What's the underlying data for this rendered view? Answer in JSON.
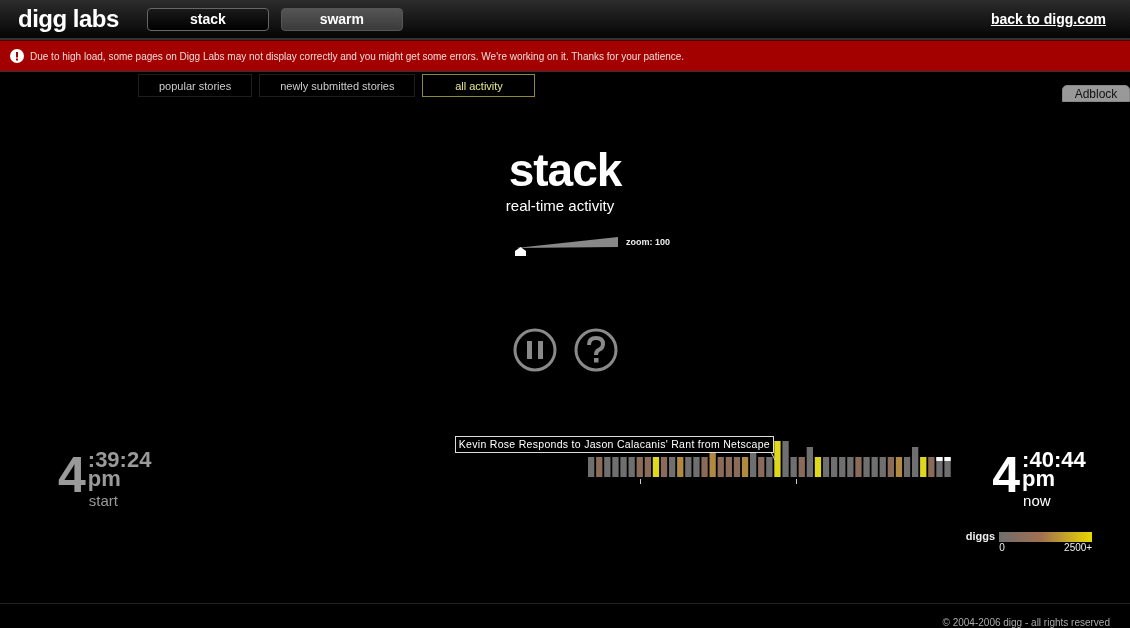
{
  "header": {
    "logo": "digg labs",
    "tabs": [
      {
        "label": "stack",
        "selected": true
      },
      {
        "label": "swarm",
        "selected": false
      }
    ],
    "back_link": "back to digg.com"
  },
  "alert": {
    "message": "Due to high load, some pages on Digg Labs may not display correctly and you might get some errors. We're working on it. Thanks for your patience."
  },
  "filter_tabs": [
    {
      "label": "popular stories",
      "selected": false
    },
    {
      "label": "newly submitted stories",
      "selected": false
    },
    {
      "label": "all activity",
      "selected": true
    }
  ],
  "adblock_tab": "Adblock",
  "title": "stack",
  "subtitle": "real-time activity",
  "zoom": {
    "label": "zoom: 100",
    "level": 0.03
  },
  "timeline": {
    "tooltip": "Kevin Rose Responds to Jason Calacanis' Rant from Netscape",
    "start": {
      "hour": "4",
      "minsec": ":39:24",
      "ampm": "pm",
      "label": "start"
    },
    "now": {
      "hour": "4",
      "minsec": ":40:44",
      "ampm": "pm",
      "label": "now"
    }
  },
  "legend": {
    "title": "diggs",
    "min": "0",
    "max": "2500+"
  },
  "footer": "© 2004-2006 digg - all rights reserved"
}
